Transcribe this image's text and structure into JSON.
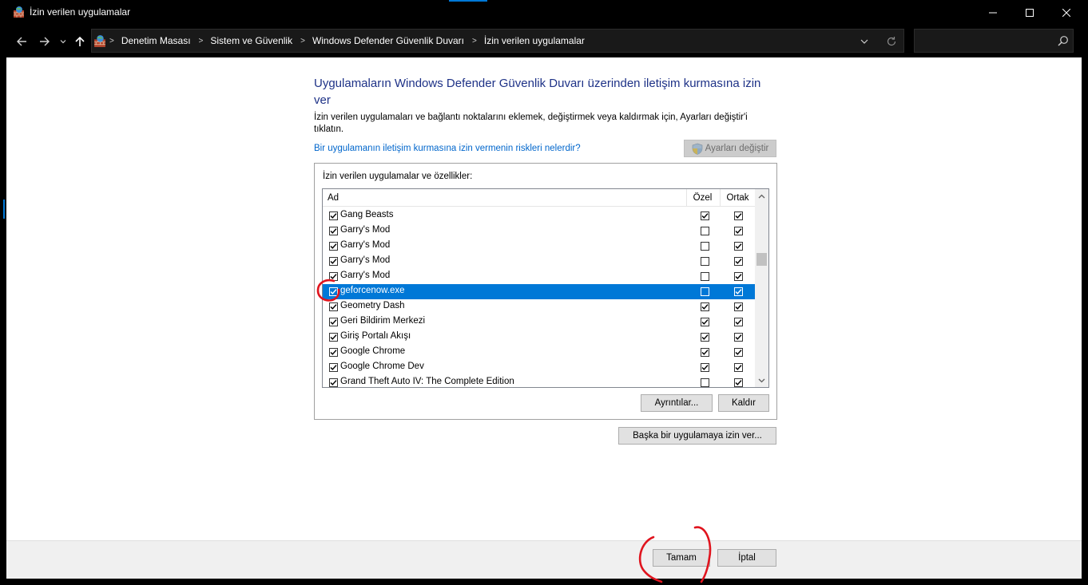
{
  "window": {
    "title": "İzin verilen uygulamalar",
    "icon": "firewall-icon",
    "accent_color": "#0078d7"
  },
  "breadcrumb": [
    "Denetim Masası",
    "Sistem ve Güvenlik",
    "Windows Defender Güvenlik Duvarı",
    "İzin verilen uygulamalar"
  ],
  "search": {
    "value": "",
    "placeholder": ""
  },
  "main": {
    "heading": "Uygulamaların Windows Defender Güvenlik Duvarı üzerinden iletişim kurmasına izin ver",
    "description": "İzin verilen uygulamaları ve bağlantı noktalarını eklemek, değiştirmek veya kaldırmak için, Ayarları değiştir'i tıklatın.",
    "risk_link": "Bir uygulamanın iletişim kurmasına izin vermenin riskleri nelerdir?",
    "change_settings_label": "Ayarları değiştir",
    "group_label": "İzin verilen uygulamalar ve özellikler:",
    "columns": {
      "name": "Ad",
      "private": "Özel",
      "public": "Ortak"
    },
    "apps": [
      {
        "name": "Gang Beasts",
        "enabled": true,
        "private": true,
        "public": true,
        "selected": false
      },
      {
        "name": "Garry's Mod",
        "enabled": true,
        "private": false,
        "public": true,
        "selected": false
      },
      {
        "name": "Garry's Mod",
        "enabled": true,
        "private": false,
        "public": true,
        "selected": false
      },
      {
        "name": "Garry's Mod",
        "enabled": true,
        "private": false,
        "public": true,
        "selected": false
      },
      {
        "name": "Garry's Mod",
        "enabled": true,
        "private": false,
        "public": true,
        "selected": false
      },
      {
        "name": "geforcenow.exe",
        "enabled": true,
        "private": false,
        "public": true,
        "selected": true
      },
      {
        "name": "Geometry Dash",
        "enabled": true,
        "private": true,
        "public": true,
        "selected": false
      },
      {
        "name": "Geri Bildirim Merkezi",
        "enabled": true,
        "private": true,
        "public": true,
        "selected": false
      },
      {
        "name": "Giriş Portalı Akışı",
        "enabled": true,
        "private": true,
        "public": true,
        "selected": false
      },
      {
        "name": "Google Chrome",
        "enabled": true,
        "private": true,
        "public": true,
        "selected": false
      },
      {
        "name": "Google Chrome Dev",
        "enabled": true,
        "private": true,
        "public": true,
        "selected": false
      },
      {
        "name": "Grand Theft Auto IV: The Complete Edition",
        "enabled": true,
        "private": false,
        "public": true,
        "selected": false
      }
    ],
    "details_label": "Ayrıntılar...",
    "remove_label": "Kaldır",
    "allow_other_label": "Başka bir uygulamaya izin ver..."
  },
  "footer": {
    "ok_label": "Tamam",
    "cancel_label": "İptal"
  },
  "annotation_color": "#e0141e",
  "selection_color": "#0078d7"
}
